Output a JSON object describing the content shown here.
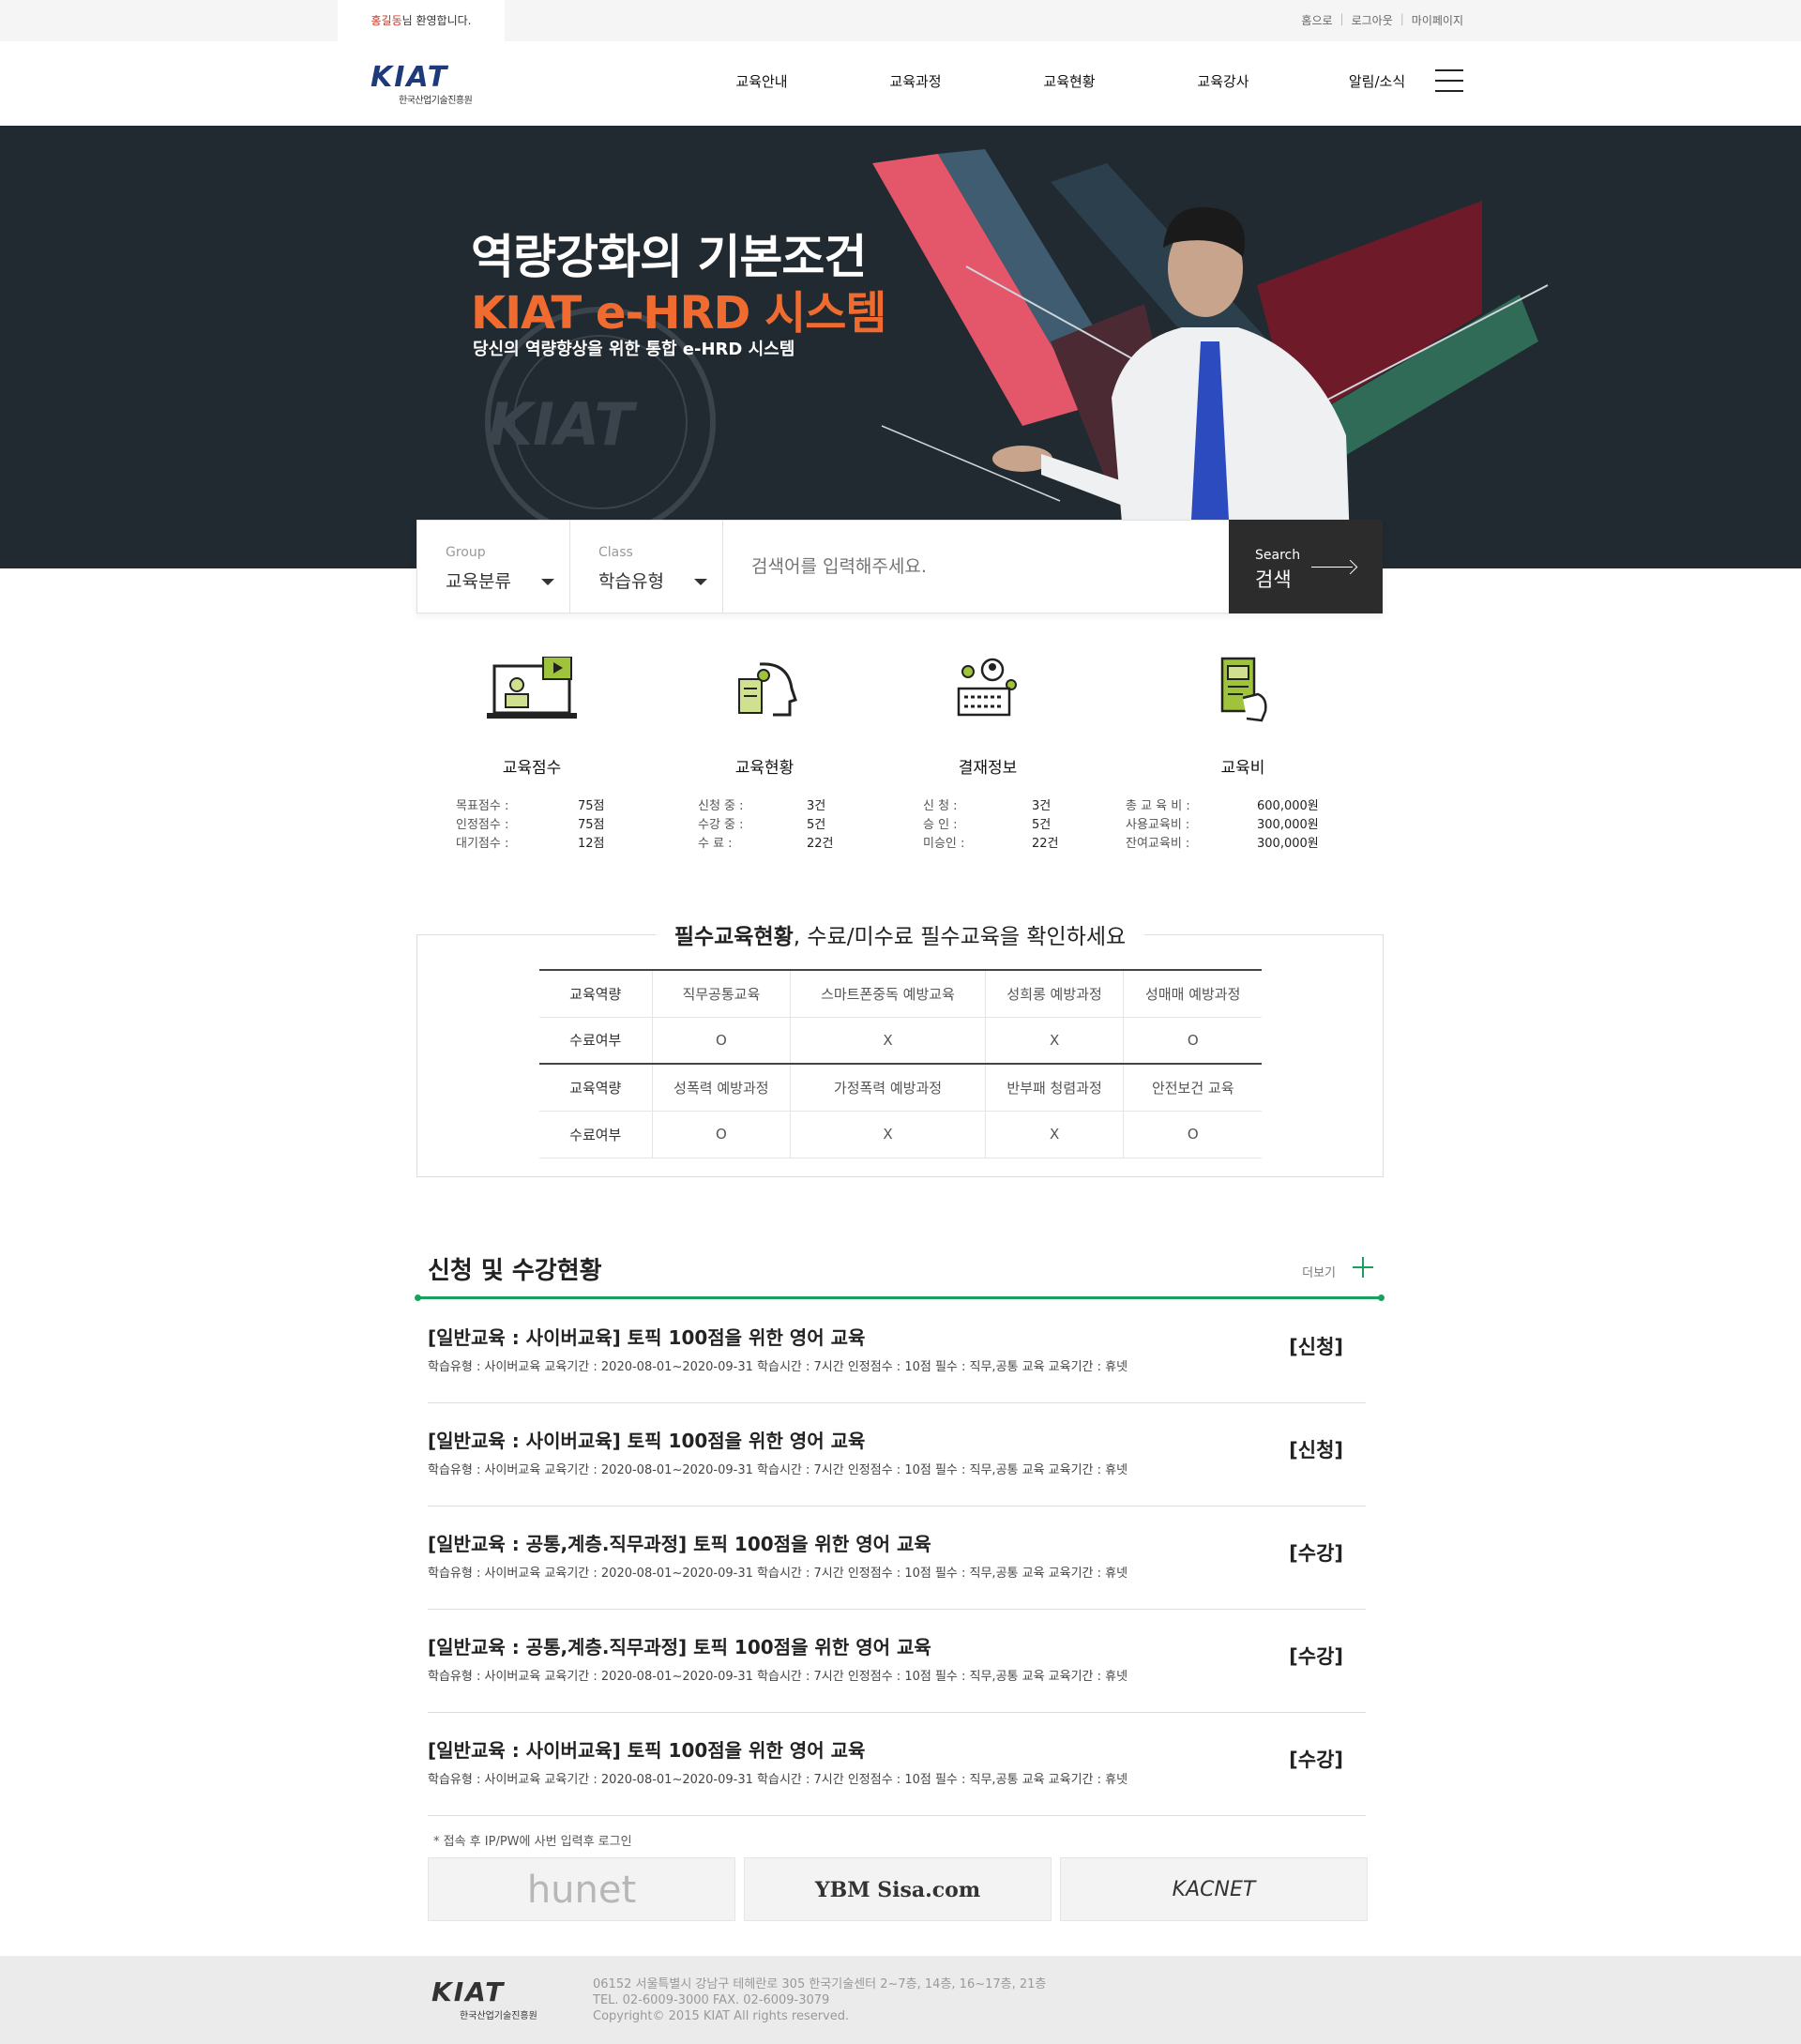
{
  "util": {
    "welcome_name": "홍길동",
    "welcome_suffix": "님 환영합니다.",
    "links": [
      "홈으로",
      "로그아웃",
      "마이페이지"
    ]
  },
  "header": {
    "logo_text": "KIAT",
    "logo_sub": "한국산업기술진흥원",
    "nav": [
      "교육안내",
      "교육과정",
      "교육현황",
      "교육강사",
      "알림/소식"
    ]
  },
  "hero": {
    "line1": "역량강화의 기본조건",
    "line2": "KIAT e-HRD 시스템",
    "line3": "당신의  역량향상을 위한 통합 e-HRD 시스템"
  },
  "search": {
    "group_label": "Group",
    "group_value": "교육분류",
    "class_label": "Class",
    "class_value": "학습유형",
    "placeholder": "검색어를 입력해주세요.",
    "button_en": "Search",
    "button_ko": "검색"
  },
  "stats": [
    {
      "icon": "monitor-video-icon",
      "title": "교육점수",
      "rows": [
        {
          "k": "목표점수 :",
          "v": "75점"
        },
        {
          "k": "인정점수 :",
          "v": "75점"
        },
        {
          "k": "대기점수 :",
          "v": "12점"
        }
      ]
    },
    {
      "icon": "head-document-icon",
      "title": "교육현황",
      "rows": [
        {
          "k": "신청 중 :",
          "v": "3건"
        },
        {
          "k": "수강 중 :",
          "v": "5건"
        },
        {
          "k": "수    료 :",
          "v": "22건"
        }
      ]
    },
    {
      "icon": "keyboard-user-icon",
      "title": "결재정보",
      "rows": [
        {
          "k": "신    청 :",
          "v": "3건"
        },
        {
          "k": "승    인 :",
          "v": "5건"
        },
        {
          "k": "미승인 :",
          "v": "22건"
        }
      ]
    },
    {
      "icon": "mobile-hand-icon",
      "title": "교육비",
      "rows": [
        {
          "k": "총 교 육 비 :",
          "v": "600,000원"
        },
        {
          "k": "사용교육비 :",
          "v": "300,000원"
        },
        {
          "k": "잔여교육비 :",
          "v": "300,000원"
        }
      ]
    }
  ],
  "required": {
    "title_bold": "필수교육현황",
    "title_rest": ", 수료/미수료 필수교육을 확인하세요",
    "row_label_course": "교육역량",
    "row_label_done": "수료여부",
    "group1": {
      "courses": [
        "직무공통교육",
        "스마트폰중독 예방교육",
        "성희롱 예방과정",
        "성매매 예방과정"
      ],
      "status": [
        "O",
        "X",
        "X",
        "O"
      ]
    },
    "group2": {
      "courses": [
        "성폭력 예방과정",
        "가정폭력 예방과정",
        "반부패 청렴과정",
        "안전보건 교육"
      ],
      "status": [
        "O",
        "X",
        "X",
        "O"
      ]
    }
  },
  "apply": {
    "title": "신청 및 수강현황",
    "more": "더보기",
    "items": [
      {
        "title": "[일반교육 : 사이버교육] 토픽 100점을 위한 영어 교육",
        "meta": "학습유형 : 사이버교육    교육기간 : 2020-08-01~2020-09-31    학습시간 : 7시간    인정점수 : 10점    필수 : 직무,공통 교육    교육기간 : 휴넷",
        "status": "[신청]"
      },
      {
        "title": "[일반교육 : 사이버교육] 토픽 100점을 위한 영어 교육",
        "meta": "학습유형 : 사이버교육    교육기간 : 2020-08-01~2020-09-31    학습시간 : 7시간    인정점수 : 10점    필수 : 직무,공통 교육    교육기간 : 휴넷",
        "status": "[신청]"
      },
      {
        "title": "[일반교육 : 공통,계층.직무과정] 토픽 100점을 위한 영어 교육",
        "meta": "학습유형 : 사이버교육    교육기간 : 2020-08-01~2020-09-31    학습시간 : 7시간    인정점수 : 10점    필수 : 직무,공통 교육    교육기간 : 휴넷",
        "status": "[수강]"
      },
      {
        "title": "[일반교육 : 공통,계층.직무과정] 토픽 100점을 위한 영어 교육",
        "meta": "학습유형 : 사이버교육    교육기간 : 2020-08-01~2020-09-31    학습시간 : 7시간    인정점수 : 10점    필수 : 직무,공통 교육    교육기간 : 휴넷",
        "status": "[수강]"
      },
      {
        "title": "[일반교육 : 사이버교육] 토픽 100점을 위한 영어 교육",
        "meta": "학습유형 : 사이버교육    교육기간 : 2020-08-01~2020-09-31    학습시간 : 7시간    인정점수 : 10점    필수 : 직무,공통 교육    교육기간 : 휴넷",
        "status": "[수강]"
      }
    ]
  },
  "note": "* 접속 후 IP/PW에 사번 입력후 로그인",
  "partners": [
    "hunet",
    "YBM Sisa.com",
    "KACNET"
  ],
  "footer": {
    "logo_text": "KIAT",
    "logo_sub": "한국산업기술진흥원",
    "address": "06152 서울특별시 강남구 테헤란로 305 한국기술센터 2~7층, 14층, 16~17층, 21층",
    "tel": "TEL. 02-6009-3000 FAX. 02-6009-3079",
    "copyright": "Copyright© 2015 KIAT All rights reserved."
  },
  "colors": {
    "accent_green": "#19a05c",
    "hero_orange": "#f06b2f",
    "hero_bg": "#212a31",
    "brand_blue": "#1e3a7b"
  }
}
